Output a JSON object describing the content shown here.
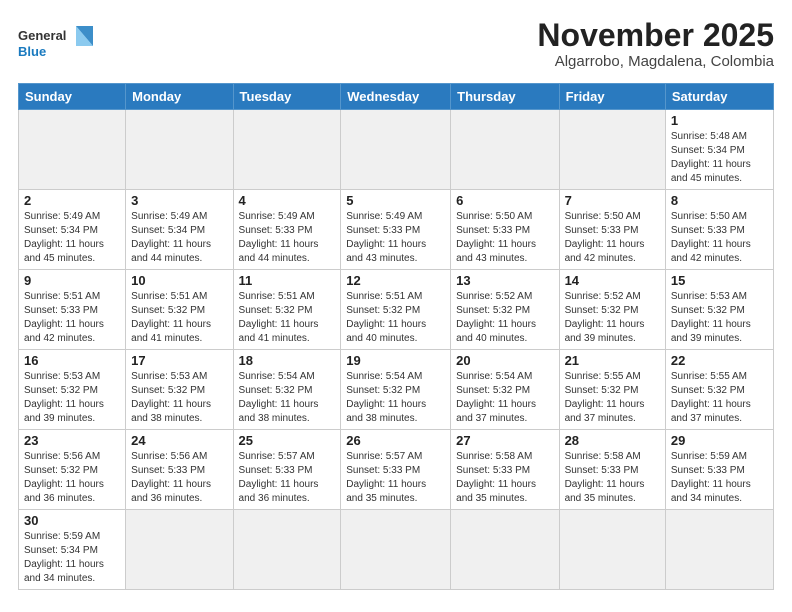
{
  "header": {
    "logo_general": "General",
    "logo_blue": "Blue",
    "month_title": "November 2025",
    "subtitle": "Algarrobo, Magdalena, Colombia"
  },
  "weekdays": [
    "Sunday",
    "Monday",
    "Tuesday",
    "Wednesday",
    "Thursday",
    "Friday",
    "Saturday"
  ],
  "weeks": [
    [
      {
        "day": "",
        "info": ""
      },
      {
        "day": "",
        "info": ""
      },
      {
        "day": "",
        "info": ""
      },
      {
        "day": "",
        "info": ""
      },
      {
        "day": "",
        "info": ""
      },
      {
        "day": "",
        "info": ""
      },
      {
        "day": "1",
        "info": "Sunrise: 5:48 AM\nSunset: 5:34 PM\nDaylight: 11 hours\nand 45 minutes."
      }
    ],
    [
      {
        "day": "2",
        "info": "Sunrise: 5:49 AM\nSunset: 5:34 PM\nDaylight: 11 hours\nand 45 minutes."
      },
      {
        "day": "3",
        "info": "Sunrise: 5:49 AM\nSunset: 5:34 PM\nDaylight: 11 hours\nand 44 minutes."
      },
      {
        "day": "4",
        "info": "Sunrise: 5:49 AM\nSunset: 5:33 PM\nDaylight: 11 hours\nand 44 minutes."
      },
      {
        "day": "5",
        "info": "Sunrise: 5:49 AM\nSunset: 5:33 PM\nDaylight: 11 hours\nand 43 minutes."
      },
      {
        "day": "6",
        "info": "Sunrise: 5:50 AM\nSunset: 5:33 PM\nDaylight: 11 hours\nand 43 minutes."
      },
      {
        "day": "7",
        "info": "Sunrise: 5:50 AM\nSunset: 5:33 PM\nDaylight: 11 hours\nand 42 minutes."
      },
      {
        "day": "8",
        "info": "Sunrise: 5:50 AM\nSunset: 5:33 PM\nDaylight: 11 hours\nand 42 minutes."
      }
    ],
    [
      {
        "day": "9",
        "info": "Sunrise: 5:51 AM\nSunset: 5:33 PM\nDaylight: 11 hours\nand 42 minutes."
      },
      {
        "day": "10",
        "info": "Sunrise: 5:51 AM\nSunset: 5:32 PM\nDaylight: 11 hours\nand 41 minutes."
      },
      {
        "day": "11",
        "info": "Sunrise: 5:51 AM\nSunset: 5:32 PM\nDaylight: 11 hours\nand 41 minutes."
      },
      {
        "day": "12",
        "info": "Sunrise: 5:51 AM\nSunset: 5:32 PM\nDaylight: 11 hours\nand 40 minutes."
      },
      {
        "day": "13",
        "info": "Sunrise: 5:52 AM\nSunset: 5:32 PM\nDaylight: 11 hours\nand 40 minutes."
      },
      {
        "day": "14",
        "info": "Sunrise: 5:52 AM\nSunset: 5:32 PM\nDaylight: 11 hours\nand 39 minutes."
      },
      {
        "day": "15",
        "info": "Sunrise: 5:53 AM\nSunset: 5:32 PM\nDaylight: 11 hours\nand 39 minutes."
      }
    ],
    [
      {
        "day": "16",
        "info": "Sunrise: 5:53 AM\nSunset: 5:32 PM\nDaylight: 11 hours\nand 39 minutes."
      },
      {
        "day": "17",
        "info": "Sunrise: 5:53 AM\nSunset: 5:32 PM\nDaylight: 11 hours\nand 38 minutes."
      },
      {
        "day": "18",
        "info": "Sunrise: 5:54 AM\nSunset: 5:32 PM\nDaylight: 11 hours\nand 38 minutes."
      },
      {
        "day": "19",
        "info": "Sunrise: 5:54 AM\nSunset: 5:32 PM\nDaylight: 11 hours\nand 38 minutes."
      },
      {
        "day": "20",
        "info": "Sunrise: 5:54 AM\nSunset: 5:32 PM\nDaylight: 11 hours\nand 37 minutes."
      },
      {
        "day": "21",
        "info": "Sunrise: 5:55 AM\nSunset: 5:32 PM\nDaylight: 11 hours\nand 37 minutes."
      },
      {
        "day": "22",
        "info": "Sunrise: 5:55 AM\nSunset: 5:32 PM\nDaylight: 11 hours\nand 37 minutes."
      }
    ],
    [
      {
        "day": "23",
        "info": "Sunrise: 5:56 AM\nSunset: 5:32 PM\nDaylight: 11 hours\nand 36 minutes."
      },
      {
        "day": "24",
        "info": "Sunrise: 5:56 AM\nSunset: 5:33 PM\nDaylight: 11 hours\nand 36 minutes."
      },
      {
        "day": "25",
        "info": "Sunrise: 5:57 AM\nSunset: 5:33 PM\nDaylight: 11 hours\nand 36 minutes."
      },
      {
        "day": "26",
        "info": "Sunrise: 5:57 AM\nSunset: 5:33 PM\nDaylight: 11 hours\nand 35 minutes."
      },
      {
        "day": "27",
        "info": "Sunrise: 5:58 AM\nSunset: 5:33 PM\nDaylight: 11 hours\nand 35 minutes."
      },
      {
        "day": "28",
        "info": "Sunrise: 5:58 AM\nSunset: 5:33 PM\nDaylight: 11 hours\nand 35 minutes."
      },
      {
        "day": "29",
        "info": "Sunrise: 5:59 AM\nSunset: 5:33 PM\nDaylight: 11 hours\nand 34 minutes."
      }
    ],
    [
      {
        "day": "30",
        "info": "Sunrise: 5:59 AM\nSunset: 5:34 PM\nDaylight: 11 hours\nand 34 minutes."
      },
      {
        "day": "",
        "info": ""
      },
      {
        "day": "",
        "info": ""
      },
      {
        "day": "",
        "info": ""
      },
      {
        "day": "",
        "info": ""
      },
      {
        "day": "",
        "info": ""
      },
      {
        "day": "",
        "info": ""
      }
    ]
  ]
}
